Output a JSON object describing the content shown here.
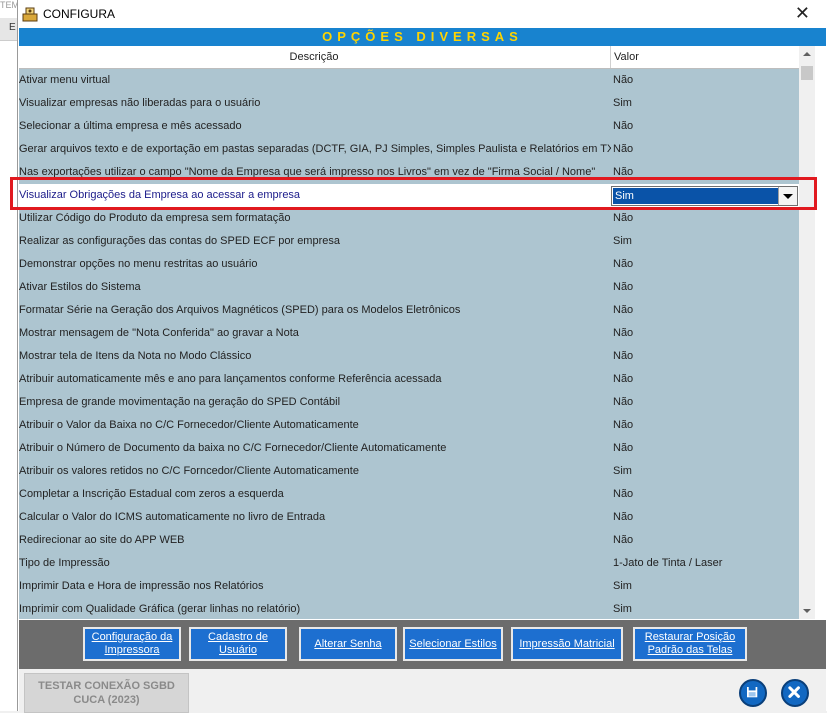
{
  "background": {
    "corner_text": "TEM",
    "tab_letter": "E"
  },
  "window": {
    "title": "CONFIGURA",
    "close_glyph": "✕"
  },
  "banner": "OPÇÕES DIVERSAS",
  "columns": {
    "description": "Descrição",
    "value": "Valor"
  },
  "rows": [
    {
      "desc": "Ativar menu virtual",
      "val": "Não"
    },
    {
      "desc": "Visualizar empresas não liberadas para o usuário",
      "val": "Sim"
    },
    {
      "desc": "Selecionar a última empresa e mês acessado",
      "val": "Não"
    },
    {
      "desc": "Gerar arquivos texto e de exportação em pastas separadas (DCTF, GIA, PJ Simples, Simples Paulista e Relatórios em TXT)",
      "val": "Não"
    },
    {
      "desc": "Nas exportações utilizar o campo \"Nome da Empresa que será impresso nos Livros\" em vez de \"Firma Social / Nome\"",
      "val": "Não"
    },
    {
      "desc": "Visualizar Obrigações da Empresa ao acessar a empresa",
      "val": "Sim"
    },
    {
      "desc": "Utilizar Código do Produto da empresa sem formatação",
      "val": "Não"
    },
    {
      "desc": "Realizar as configurações das contas do SPED ECF por empresa",
      "val": "Sim"
    },
    {
      "desc": "Demonstrar opções no menu restritas ao usuário",
      "val": "Não"
    },
    {
      "desc": "Ativar Estilos do Sistema",
      "val": "Não"
    },
    {
      "desc": "Formatar Série na Geração dos Arquivos Magnéticos (SPED) para os Modelos Eletrônicos",
      "val": "Não"
    },
    {
      "desc": "Mostrar mensagem de \"Nota Conferida\" ao gravar a Nota",
      "val": "Não"
    },
    {
      "desc": "Mostrar tela de Itens da Nota no Modo Clássico",
      "val": "Não"
    },
    {
      "desc": "Atribuir automaticamente mês e ano para lançamentos conforme Referência acessada",
      "val": "Não"
    },
    {
      "desc": "Empresa de grande movimentação na geração do SPED Contábil",
      "val": "Não"
    },
    {
      "desc": "Atribuir o Valor da Baixa no C/C Fornecedor/Cliente Automaticamente",
      "val": "Não"
    },
    {
      "desc": "Atribuir o Número de Documento da baixa no C/C Fornecedor/Cliente Automaticamente",
      "val": "Não"
    },
    {
      "desc": "Atribuir os valores retidos no C/C Forncedor/Cliente Automaticamente",
      "val": "Sim"
    },
    {
      "desc": "Completar a Inscrição Estadual com zeros a esquerda",
      "val": "Não"
    },
    {
      "desc": "Calcular o Valor do ICMS automaticamente no livro de Entrada",
      "val": "Não"
    },
    {
      "desc": "Redirecionar ao site do APP WEB",
      "val": "Não"
    },
    {
      "desc": "Tipo de Impressão",
      "val": "1-Jato de Tinta / Laser"
    },
    {
      "desc": "Imprimir Data e Hora de impressão nos Relatórios",
      "val": "Sim"
    },
    {
      "desc": "Imprimir com Qualidade Gráfica (gerar linhas no relatório)",
      "val": "Sim"
    }
  ],
  "selected_index": 5,
  "toolbar": {
    "config_printer": "Configuração da Impressora",
    "user_register": "Cadastro de Usuário",
    "change_password": "Alterar Senha",
    "select_styles": "Selecionar Estilos",
    "matrix_print": "Impressão Matricial",
    "restore_position": "Restaurar Posição Padrão das Telas"
  },
  "footer": {
    "test_connection": "TESTAR CONEXÃO SGBD CUCA (2023)"
  },
  "colors": {
    "banner_bg": "#1883cf",
    "banner_text": "#ffd400",
    "grid_bg": "#adc5d0",
    "button_bg": "#1d6fd0",
    "highlight": "#e1191f"
  },
  "icons": [
    "app-icon",
    "close-icon",
    "dropdown-arrow-icon",
    "save-icon",
    "exit-icon",
    "scroll-up-icon",
    "scroll-down-icon"
  ]
}
